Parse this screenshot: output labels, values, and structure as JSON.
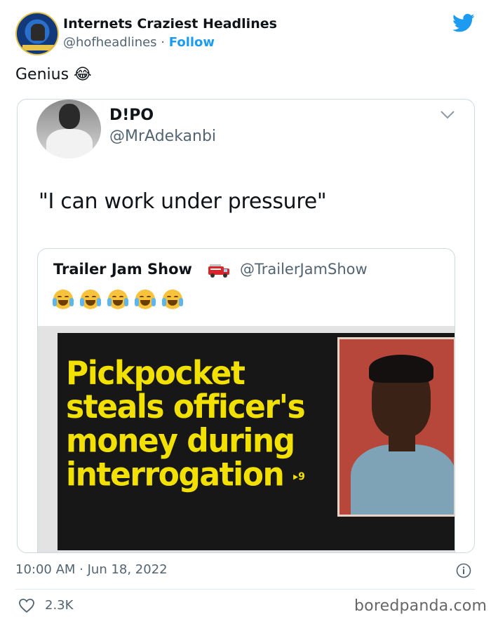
{
  "tweet": {
    "author_name": "Internets Craziest Headlines",
    "author_handle": "@hofheadlines",
    "separator": "·",
    "follow_label": "Follow",
    "text": "Genius 😂",
    "timestamp": "10:00 AM · Jun 18, 2022",
    "like_count": "2.3K",
    "colors": {
      "accent": "#1d9bf0",
      "muted": "#536471"
    }
  },
  "quoted_tweet": {
    "author_name": "D!PO",
    "author_handle": "@MrAdekanbi",
    "text": "\"I can work under pressure\""
  },
  "inner_quoted": {
    "author_name": "Trailer Jam Show",
    "author_handle": "@TrailerJamShow",
    "truck_icon": "fire-engine-emoji-icon",
    "emojis": [
      "crying-face",
      "crying-face",
      "tears-of-joy-face",
      "tears-of-joy-face",
      "tears-of-joy-face"
    ],
    "image": {
      "headline_lines": [
        "Pickpocket",
        "steals officer's",
        "money during",
        "interrogation"
      ],
      "page_mark": "▸9",
      "headline_color": "#f2e100"
    }
  },
  "watermark": "boredpanda.com"
}
